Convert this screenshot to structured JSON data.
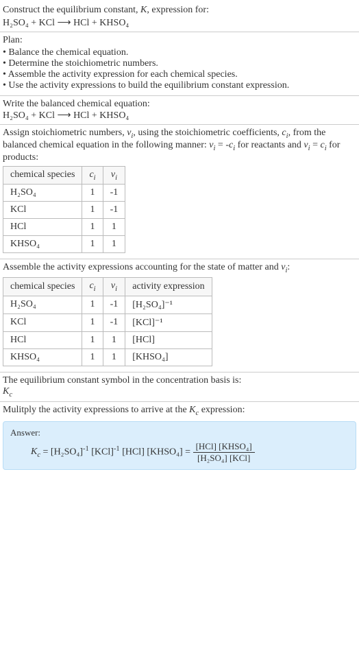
{
  "title": {
    "line1": "Construct the equilibrium constant, K, expression for:",
    "equation": "H₂SO₄ + KCl ⟶ HCl + KHSO₄"
  },
  "plan": {
    "header": "Plan:",
    "items": [
      "Balance the chemical equation.",
      "Determine the stoichiometric numbers.",
      "Assemble the activity expression for each chemical species.",
      "Use the activity expressions to build the equilibrium constant expression."
    ]
  },
  "balanced": {
    "header": "Write the balanced chemical equation:",
    "equation": "H₂SO₄ + KCl ⟶ HCl + KHSO₄"
  },
  "stoich": {
    "header_a": "Assign stoichiometric numbers, νᵢ, using the stoichiometric coefficients, cᵢ, from the balanced chemical equation in the following manner: νᵢ = -cᵢ for reactants and νᵢ = cᵢ for products:",
    "cols": [
      "chemical species",
      "cᵢ",
      "νᵢ"
    ],
    "rows": [
      {
        "species": "H₂SO₄",
        "c": "1",
        "v": "-1"
      },
      {
        "species": "KCl",
        "c": "1",
        "v": "-1"
      },
      {
        "species": "HCl",
        "c": "1",
        "v": "1"
      },
      {
        "species": "KHSO₄",
        "c": "1",
        "v": "1"
      }
    ]
  },
  "activity": {
    "header": "Assemble the activity expressions accounting for the state of matter and νᵢ:",
    "cols": [
      "chemical species",
      "cᵢ",
      "νᵢ",
      "activity expression"
    ],
    "rows": [
      {
        "species": "H₂SO₄",
        "c": "1",
        "v": "-1",
        "expr": "[H₂SO₄]⁻¹"
      },
      {
        "species": "KCl",
        "c": "1",
        "v": "-1",
        "expr": "[KCl]⁻¹"
      },
      {
        "species": "HCl",
        "c": "1",
        "v": "1",
        "expr": "[HCl]"
      },
      {
        "species": "KHSO₄",
        "c": "1",
        "v": "1",
        "expr": "[KHSO₄]"
      }
    ]
  },
  "kc_symbol": {
    "line1": "The equilibrium constant symbol in the concentration basis is:",
    "line2": "K_c"
  },
  "multiply": {
    "header": "Mulitply the activity expressions to arrive at the K_c expression:"
  },
  "answer": {
    "label": "Answer:",
    "lhs": "K_c = [H₂SO₄]⁻¹ [KCl]⁻¹ [HCl] [KHSO₄] = ",
    "frac_num": "[HCl] [KHSO₄]",
    "frac_den": "[H₂SO₄] [KCl]"
  }
}
